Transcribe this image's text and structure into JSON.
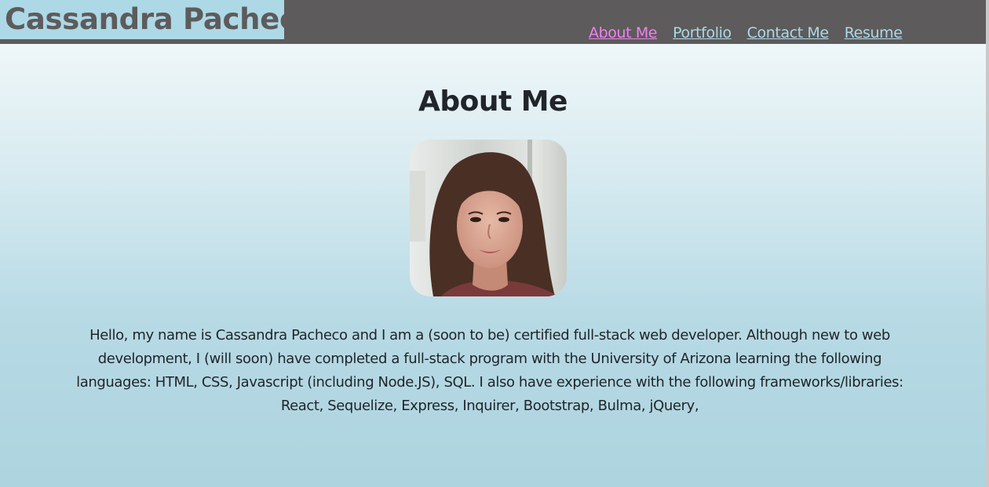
{
  "header": {
    "brand": "Cassandra Pacheco",
    "nav": [
      {
        "label": "About Me",
        "active": true
      },
      {
        "label": "Portfolio",
        "active": false
      },
      {
        "label": "Contact Me",
        "active": false
      },
      {
        "label": "Resume",
        "active": false
      }
    ]
  },
  "colors": {
    "header_bg": "#5d5b5c",
    "brand_bg": "#add8e6",
    "nav_link": "#add8e6",
    "nav_active": "#ee82ee"
  },
  "main": {
    "title": "About Me",
    "bio": "Hello, my name is Cassandra Pacheco and I am a (soon to be) certified full-stack web developer. Although new to web development, I (will soon) have completed a full-stack program with the University of Arizona learning the following languages: HTML, CSS, Javascript (including Node.JS), SQL. I also have experience with the following frameworks/libraries: React, Sequelize, Express, Inquirer, Bootstrap, Bulma, jQuery,"
  }
}
